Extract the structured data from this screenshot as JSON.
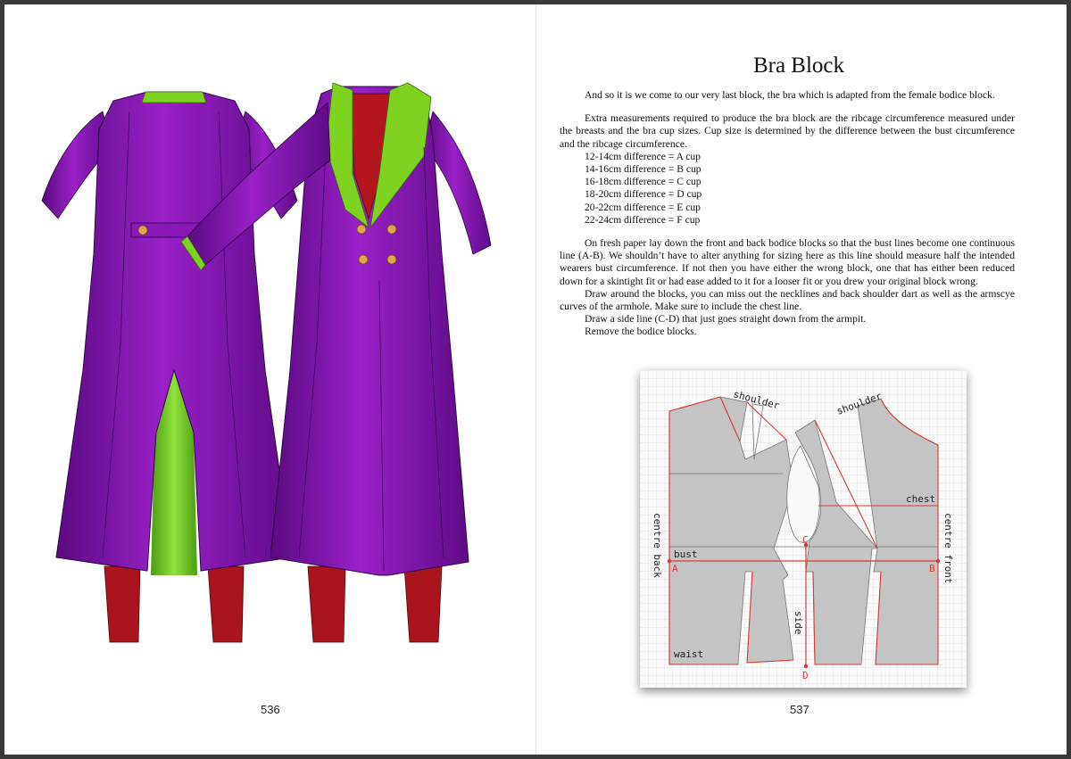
{
  "left_page": {
    "page_number": "536"
  },
  "right_page": {
    "title": "Bra Block",
    "intro": "And so it is we come to our very last block, the bra which is adapted from the female bodice block.",
    "measurements": "Extra measurements required to produce the bra block are the ribcage circumference measured under the breasts and the bra cup sizes. Cup size is determined by the difference between the bust circumference and the ribcage circumference.",
    "cup_sizes": [
      "12-14cm difference = A cup",
      "14-16cm difference = B cup",
      "16-18cm difference = C cup",
      "18-20cm difference = D cup",
      "20-22cm difference = E cup",
      "22-24cm difference = F cup"
    ],
    "step1": "On fresh paper lay down the front and back bodice blocks so that the bust lines become one continuous line (A-B). We shouldn’t have to alter anything for sizing here as this line should measure half the intended wearers bust circumference. If not then you have either the wrong block, one that has either been reduced down for a skintight fit or had ease added to it for a looser fit or you drew your original block wrong.",
    "step2": "Draw around the blocks, you can miss out the necklines and back shoulder dart as well as the armscye curves of the armhole. Make sure to include the chest line.",
    "step3": "Draw a side line (C-D) that just goes straight down from the armpit.",
    "step4": "Remove the bodice blocks.",
    "page_number": "537",
    "diagram": {
      "labels": {
        "shoulder_back": "shoulder",
        "shoulder_front": "shoulder",
        "chest": "chest",
        "bust": "bust",
        "centre_back": "centre back",
        "centre_front": "centre front",
        "side": "side",
        "waist": "waist",
        "a": "A",
        "b": "B",
        "c": "C",
        "d": "D"
      },
      "colors": {
        "outline": "#d43a3a",
        "block": "#c4c4c4",
        "grid": "#dcdcdc"
      }
    }
  },
  "illustration": {
    "colors": {
      "coat": "#7d12a6",
      "lining": "#7ed321",
      "trousers": "#b3151e",
      "button": "#e0a64a"
    }
  }
}
